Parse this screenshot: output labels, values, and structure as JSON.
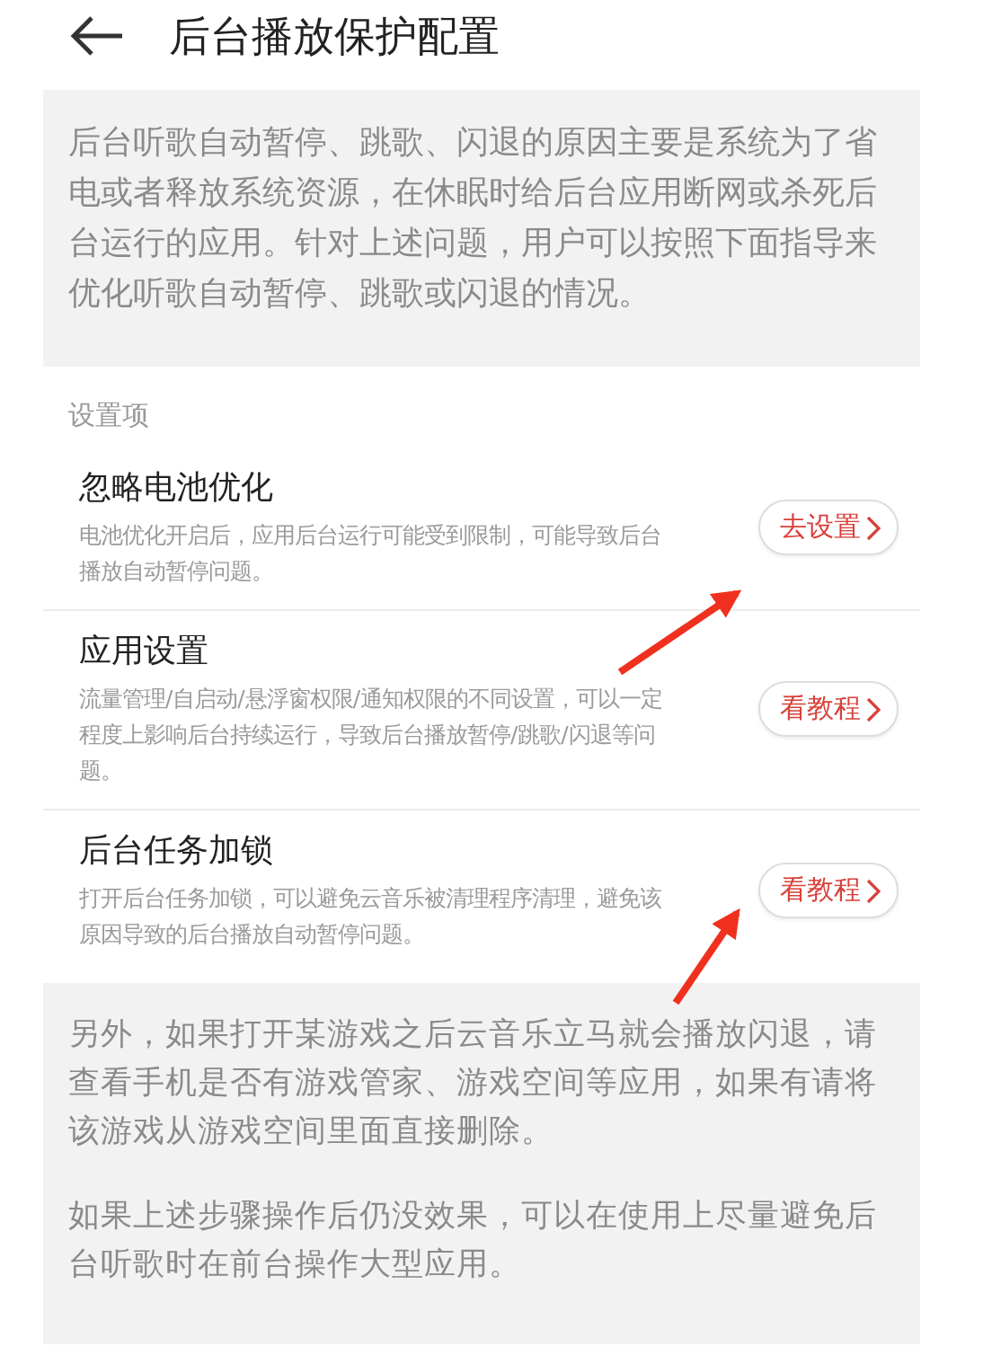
{
  "header": {
    "title": "后台播放保护配置"
  },
  "intro": "后台听歌自动暂停、跳歌、闪退的原因主要是系统为了省电或者释放系统资源，在休眠时给后台应用断网或杀死后台运行的应用。针对上述问题，用户可以按照下面指导来优化听歌自动暂停、跳歌或闪退的情况。",
  "section_label": "设置项",
  "settings": [
    {
      "title": "忽略电池优化",
      "description": "电池优化开启后，应用后台运行可能受到限制，可能导致后台播放自动暂停问题。",
      "button": "去设置"
    },
    {
      "title": "应用设置",
      "description": "流量管理/自启动/悬浮窗权限/通知权限的不同设置，可以一定程度上影响后台持续运行，导致后台播放暂停/跳歌/闪退等问题。",
      "button": "看教程"
    },
    {
      "title": "后台任务加锁",
      "description": "打开后台任务加锁，可以避免云音乐被清理程序清理，避免该原因导致的后台播放自动暂停问题。",
      "button": "看教程"
    }
  ],
  "notes": [
    "另外，如果打开某游戏之后云音乐立马就会播放闪退，请查看手机是否有游戏管家、游戏空间等应用，如果有请将该游戏从游戏空间里面直接删除。",
    "如果上述步骤操作后仍没效果，可以在使用上尽量避免后台听歌时在前台操作大型应用。"
  ]
}
